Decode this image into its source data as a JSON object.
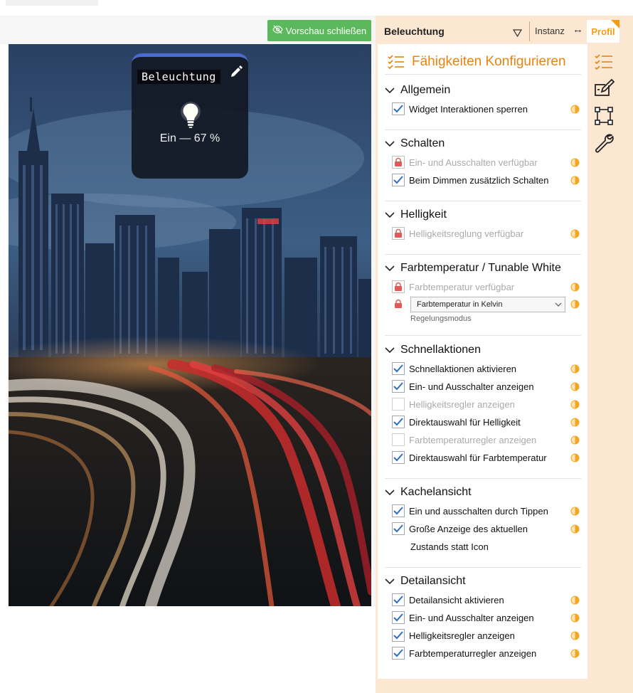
{
  "preview": {
    "close_label": "Vorschau schließen",
    "tile": {
      "title": "Beleuchtung",
      "state": "Ein — 67 %"
    }
  },
  "header": {
    "selected": "Beleuchtung",
    "instance_label": "Instanz",
    "swap_symbol": "↔",
    "profile_label": "Profil"
  },
  "content": {
    "title": "Fähigkeiten Konfigurieren",
    "sections": {
      "allgemein": {
        "title": "Allgemein",
        "items": [
          "Widget Interaktionen sperren"
        ]
      },
      "schalten": {
        "title": "Schalten",
        "items": [
          "Ein- und Ausschalten verfügbar",
          "Beim Dimmen zusätzlich Schalten"
        ]
      },
      "helligkeit": {
        "title": "Helligkeit",
        "items": [
          "Helligkeitsreglung verfügbar"
        ]
      },
      "farbtemperatur": {
        "title": "Farbtemperatur / Tunable White",
        "items": [
          "Farbtemperatur verfügbar"
        ],
        "select_value": "Farbtemperatur in Kelvin",
        "select_caption": "Regelungsmodus"
      },
      "schnellaktionen": {
        "title": "Schnellaktionen",
        "items": [
          "Schnellaktionen aktivieren",
          "Ein- und Ausschalter anzeigen",
          "Helligkeitsregler anzeigen",
          "Direktauswahl für Helligkeit",
          "Farbtemperaturregler anzeigen",
          "Direktauswahl für Farbtemperatur"
        ]
      },
      "kachelansicht": {
        "title": "Kachelansicht",
        "items": [
          "Ein und ausschalten durch Tippen",
          "Große Anzeige des aktuellen",
          "Zustands statt Icon"
        ]
      },
      "detailansicht": {
        "title": "Detailansicht",
        "items": [
          "Detailansicht aktivieren",
          "Ein- und Ausschalter anzeigen",
          "Helligkeitsregler anzeigen",
          "Farbtemperaturregler anzeigen"
        ]
      }
    }
  },
  "colors": {
    "accent": "#e8830f",
    "check": "#2f6fc1",
    "lock": "#e05a5a",
    "button_green": "#5cb85c",
    "panel_bg": "#fbe7d2"
  },
  "icons": [
    "eye-slash-icon",
    "pencil-icon",
    "bulb-icon",
    "checklist-icon",
    "edit-box-icon",
    "vector-square-icon",
    "wrench-icon",
    "lock-icon",
    "half-circle-icon",
    "chevron-down-icon",
    "triangle-down-icon"
  ]
}
